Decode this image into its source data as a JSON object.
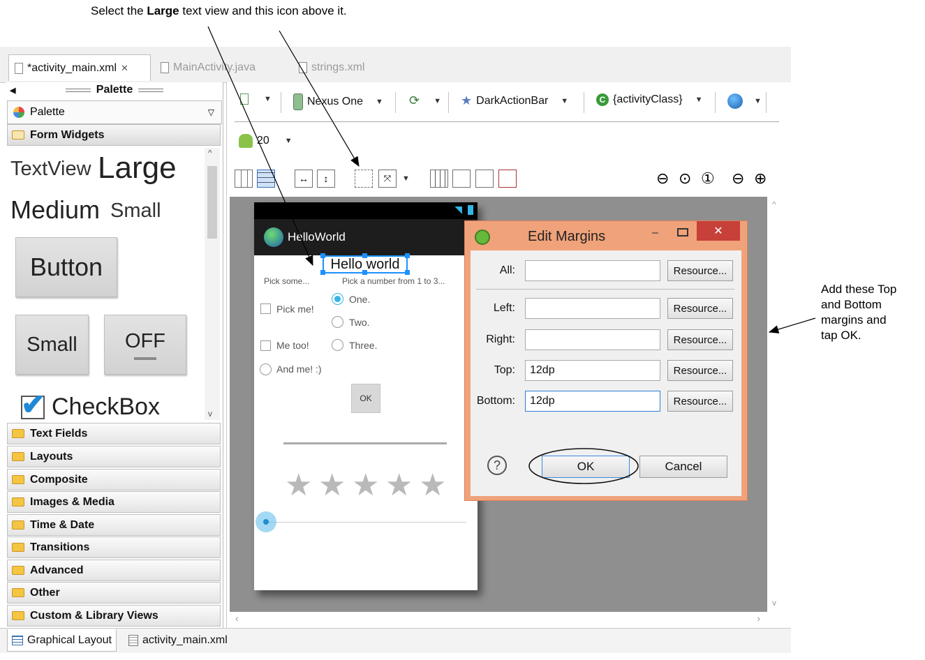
{
  "instructions": {
    "top_pre": "Select the ",
    "top_bold": "Large",
    "top_post": " text view and this icon above it.",
    "right": [
      "Add these Top",
      "and Bottom",
      "margins and",
      "tap OK."
    ]
  },
  "editor_tabs": [
    {
      "label": "*activity_main.xml",
      "active": true
    },
    {
      "label": "MainActivity.java",
      "active": false
    },
    {
      "label": "strings.xml",
      "active": false
    }
  ],
  "palette": {
    "header": "Palette",
    "select_value": "Palette",
    "open_category": "Form Widgets",
    "widgets": {
      "textview": "TextView",
      "large": "Large",
      "medium": "Medium",
      "small": "Small",
      "button": "Button",
      "small_button": "Small",
      "toggle": "OFF",
      "checkbox": "CheckBox"
    },
    "categories": [
      "Text Fields",
      "Layouts",
      "Composite",
      "Images & Media",
      "Time & Date",
      "Transitions",
      "Advanced",
      "Other",
      "Custom & Library Views"
    ]
  },
  "toolbar": {
    "device": "Nexus One",
    "theme": "DarkActionBar",
    "activity": "{activityClass}",
    "api_level": "20"
  },
  "phone": {
    "app_title": "HelloWorld",
    "hello": "Hello world",
    "pick_some": "Pick some...",
    "pick_number": "Pick a number from 1 to 3...",
    "checks": [
      "Pick me!",
      "Me too!",
      "And me! :)"
    ],
    "radios": [
      "One.",
      "Two.",
      "Three."
    ],
    "ok": "OK",
    "rating_stars": 5
  },
  "dialog": {
    "title": "Edit Margins",
    "fields": [
      {
        "label": "All:",
        "value": ""
      },
      {
        "label": "Left:",
        "value": ""
      },
      {
        "label": "Right:",
        "value": ""
      },
      {
        "label": "Top:",
        "value": "12dp"
      },
      {
        "label": "Bottom:",
        "value": "12dp"
      }
    ],
    "resource_label": "Resource...",
    "ok_label": "OK",
    "cancel_label": "Cancel"
  },
  "bottom_tabs": [
    "Graphical Layout",
    "activity_main.xml"
  ],
  "colors": {
    "dialog_frame": "#f0a27a",
    "close_button": "#c7403a",
    "selection": "#1e90ff",
    "seekbar": "#58b9ea"
  }
}
